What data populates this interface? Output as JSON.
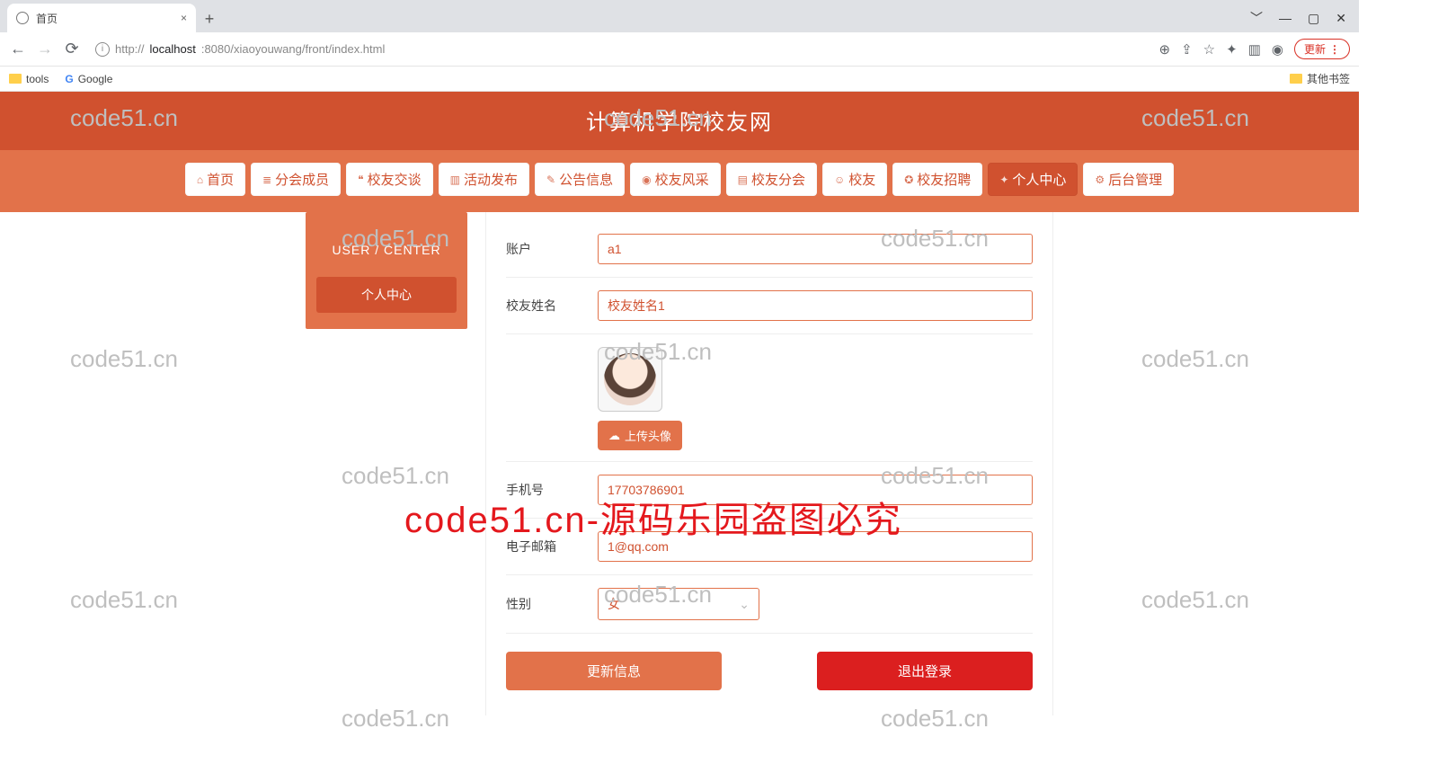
{
  "browser": {
    "tab_title": "首页",
    "new_tab_tip": "+",
    "url_prefix": "http://",
    "url_host": "localhost",
    "url_port_path": ":8080/xiaoyouwang/front/index.html",
    "update_label": "更新",
    "window_controls": [
      "﹀",
      "—",
      "▢",
      "✕"
    ]
  },
  "bookmarks": {
    "items": [
      "tools",
      "Google"
    ],
    "other": "其他书签"
  },
  "site": {
    "title": "计算机学院校友网",
    "nav": [
      {
        "icon": "⌂",
        "label": "首页"
      },
      {
        "icon": "≣",
        "label": "分会成员"
      },
      {
        "icon": "❝",
        "label": "校友交谈"
      },
      {
        "icon": "▥",
        "label": "活动发布"
      },
      {
        "icon": "✎",
        "label": "公告信息"
      },
      {
        "icon": "◉",
        "label": "校友风采"
      },
      {
        "icon": "▤",
        "label": "校友分会"
      },
      {
        "icon": "☺",
        "label": "校友"
      },
      {
        "icon": "✪",
        "label": "校友招聘"
      },
      {
        "icon": "✦",
        "label": "个人中心",
        "active": true
      },
      {
        "icon": "⚙",
        "label": "后台管理"
      }
    ]
  },
  "sidebar": {
    "subtitle": "USER / CENTER",
    "menu_label": "个人中心"
  },
  "form": {
    "account": {
      "label": "账户",
      "value": "a1"
    },
    "name": {
      "label": "校友姓名",
      "value": "校友姓名1"
    },
    "upload_label": "上传头像",
    "phone": {
      "label": "手机号",
      "value": "17703786901"
    },
    "email": {
      "label": "电子邮箱",
      "value": "1@qq.com"
    },
    "gender": {
      "label": "性别",
      "value": "女"
    },
    "btn_update": "更新信息",
    "btn_logout": "退出登录"
  },
  "watermarks": {
    "text": "code51.cn",
    "big": "code51.cn-源码乐园盗图必究"
  }
}
